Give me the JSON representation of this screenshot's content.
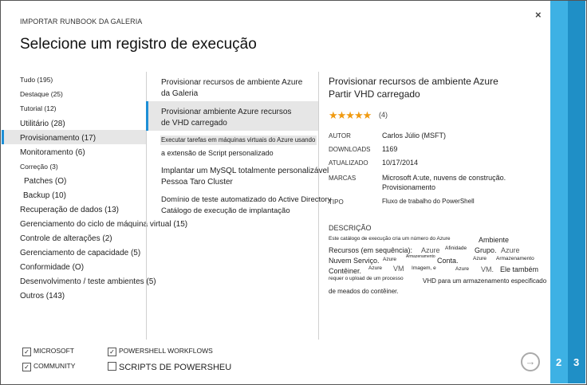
{
  "header": {
    "subtitle": "IMPORTAR RUNBOOK DA GALERIA",
    "title": "Selecione um registro de execução",
    "close": "×"
  },
  "categories": [
    "Tudo (195)",
    "Destaque (25)",
    "Tutorial (12)",
    "Utilitário (28)",
    "Provisionamento (17)",
    "Monitoramento (6)",
    "Correção (3)",
    "Patches (O)",
    "Backup (10)",
    "Recuperação de dados (13)",
    "Gerenciamento do ciclo de máquina virtual (15)",
    "Controle de alterações (2)",
    "Gerenciamento de capacidade (5)",
    "Conformidade (O)",
    "Desenvolvimento / teste ambientes (5)",
    "Outros (143)"
  ],
  "runbooks": [
    {
      "line1": "Provisionar recursos de ambiente Azure",
      "line2": "da Galeria"
    },
    {
      "line1": "Provisionar ambiente Azure recursos",
      "line2": "de VHD carregado"
    },
    {
      "line1": "Executar tarefas em máquinas virtuais do Azure usando",
      "line2": "a extensão de Script personalizado"
    },
    {
      "line1": "Implantar um MySQL totalmente personalizável",
      "line2": "Pessoa Taro Cluster"
    },
    {
      "line1": "Domínio de teste automatizado do Active Directory",
      "line2": "Catálogo de execução de implantação"
    }
  ],
  "detail": {
    "title_line1": "Provisionar recursos de ambiente Azure",
    "title_line2": "Partir VHD carregado",
    "stars": "★★★★★",
    "rating": "(4)",
    "labels": {
      "author": "AUTOR",
      "downloads": "DOWNLOADS",
      "updated": "ATUALIZADO",
      "tags": "MARCAS",
      "type": "TIPO",
      "description": "DESCRIÇÃO"
    },
    "author": "Carlos Júlio (MSFT)",
    "downloads": "1169",
    "updated": "10/17/2014",
    "tags_line1": "Microsoft A:ute, nuvens de construção.",
    "tags_line2": "Provisionamento",
    "type": "Fluxo de trabalho do PowerShell",
    "desc": {
      "t1": "Este catálogo de execução cria um número do Azure",
      "t2": "Ambiente",
      "t3": "Recursos (em sequência):",
      "t4": "Azure",
      "t5": "Afinidade",
      "t6": "Grupo.",
      "t7": "Azure",
      "t8": "Nuvem Serviço.",
      "t9": "Azure",
      "t10": "Armazenamento",
      "t11": "Conta.",
      "t12": "Azure",
      "t13": "Armazenamento",
      "t14": "Contêiner.",
      "t15": "Azure",
      "t16": "VM",
      "t17": "Imagem, e",
      "t18": "Azure",
      "t19": "VM.",
      "t20": "Ele também",
      "t21": "requer o upload de um processo",
      "t22": "VHD para um armazenamento especificado",
      "t23": "de meados do contêiner."
    }
  },
  "filters": {
    "microsoft": "MICROSOFT",
    "community": "COMMUNITY",
    "powershell_workflows": "POWERSHELL WORKFLOWS",
    "scripts": "SCRIPTS DE POWERSHEU",
    "check": "✓"
  },
  "nav": {
    "next": "→",
    "step2": "2",
    "step3": "3"
  },
  "colors": {
    "accent": "#1e8fd6",
    "side_light": "#3db1e4",
    "side_dark": "#1f8fc6",
    "star": "#f09a10"
  }
}
